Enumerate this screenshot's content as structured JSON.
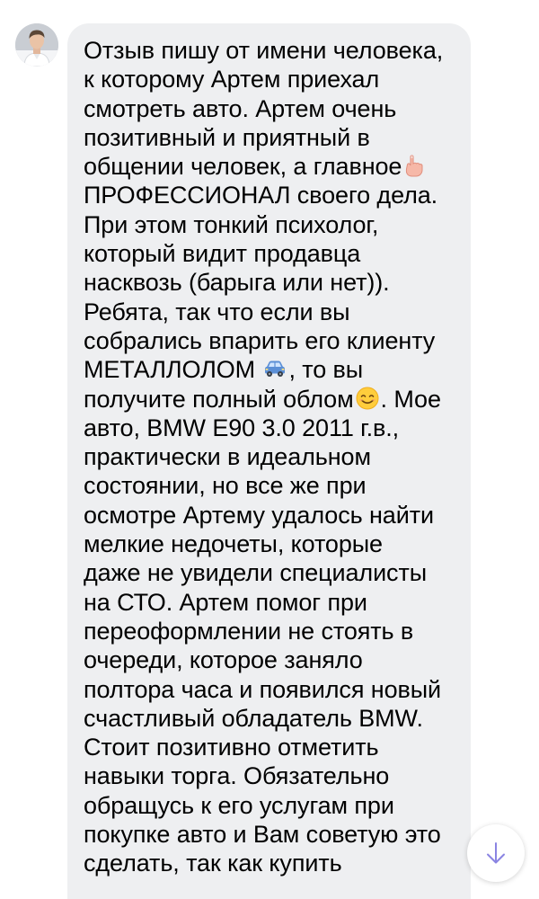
{
  "chat": {
    "avatar_icon": "user-avatar",
    "bubble_color": "#eeeff1",
    "message": {
      "part1": "Отзыв пишу от имени человека,\nк которому Артем приехал\nсмотреть авто. Артем очень\nпозитивный и приятный в\nобщении человек, а главное",
      "emoji1": "pointing-up-emoji",
      "part2": "\nПРОФЕССИОНАЛ своего дела.\nПри этом тонкий психолог,\nкоторый видит продавца\nнасквозь (барыга или нет)).\nРебята, так что если вы\nсобрались впарить его клиенту\nМЕТАЛЛОЛОМ ",
      "emoji2": "car-emoji",
      "part3": ", то вы\nполучите полный облом",
      "emoji3": "smiling-face-emoji",
      "part4": ". Мое\nавто, BMW E90 3.0 2011 г.в.,\nпрактически в идеальном\nсостоянии, но все же при\nосмотре Артему удалось найти\nмелкие недочеты, которые\nдаже не увидели специалисты\nна СТО. Артем помог при\nпереоформлении не стоять в\nочереди, которое заняло\nполтора часа и появился новый\nсчастливый обладатель BMW.\nСтоит позитивно отметить\nнавыки торга. Обязательно\nобращусь к его услугам при\nпокупке авто и Вам советую это\nсделать, так как купить"
    }
  },
  "scroll_button": {
    "icon": "arrow-down-icon",
    "accent_color": "#8a84e2"
  }
}
